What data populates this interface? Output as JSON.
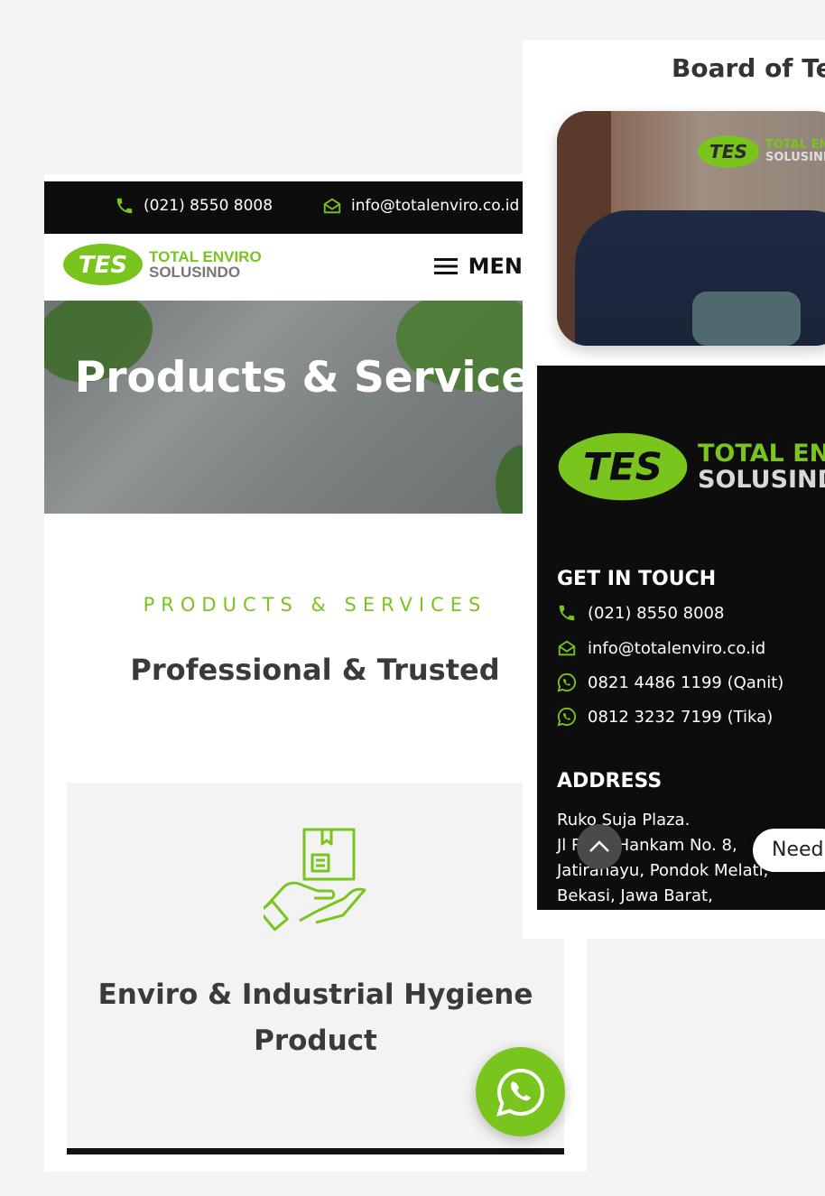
{
  "colors": {
    "accent": "#7ac41e",
    "dark": "#0d0d0d",
    "text": "#3a3a3a"
  },
  "topbar": {
    "phone": "(021) 8550 8008",
    "email": "info@totalenviro.co.id"
  },
  "brand": {
    "logo_mark": "TES",
    "line1": "TOTAL ENVIRO",
    "line2": "SOLUSINDO"
  },
  "header": {
    "menu_label": "MEN",
    "menu_icon": "hamburger-icon"
  },
  "hero": {
    "title": "Products & Services"
  },
  "section": {
    "eyebrow": "PRODUCTS & SERVICES",
    "heading": "Professional & Trusted"
  },
  "card": {
    "title": "Enviro & Industrial Hygiene Product",
    "icon": "hand-box-icon"
  },
  "right": {
    "board_title": "Board of Te",
    "photo_logo": {
      "mark": "TES",
      "line1": "TOTAL EN",
      "line2": "SOLUSIND"
    },
    "footer": {
      "logo": {
        "mark": "TES",
        "line1": "TOTAL ENV",
        "line2": "SOLUSINDO"
      },
      "contact_title": "GET IN TOUCH",
      "contacts": [
        {
          "icon": "phone-icon",
          "text": "(021) 8550 8008"
        },
        {
          "icon": "email-icon",
          "text": "info@totalenviro.co.id"
        },
        {
          "icon": "whatsapp-icon",
          "text": "0821 4486 1199 (Qanit)"
        },
        {
          "icon": "whatsapp-icon",
          "text": "0812 3232 7199 (Tika)"
        }
      ],
      "address_title": "ADDRESS",
      "address_lines": [
        "Ruko Suja Plaza.",
        "Jl Raya Hankam No. 8,",
        "Jatirahayu, Pondok Melati,",
        "Bekasi, Jawa Barat,"
      ]
    },
    "need_help": "Need"
  }
}
